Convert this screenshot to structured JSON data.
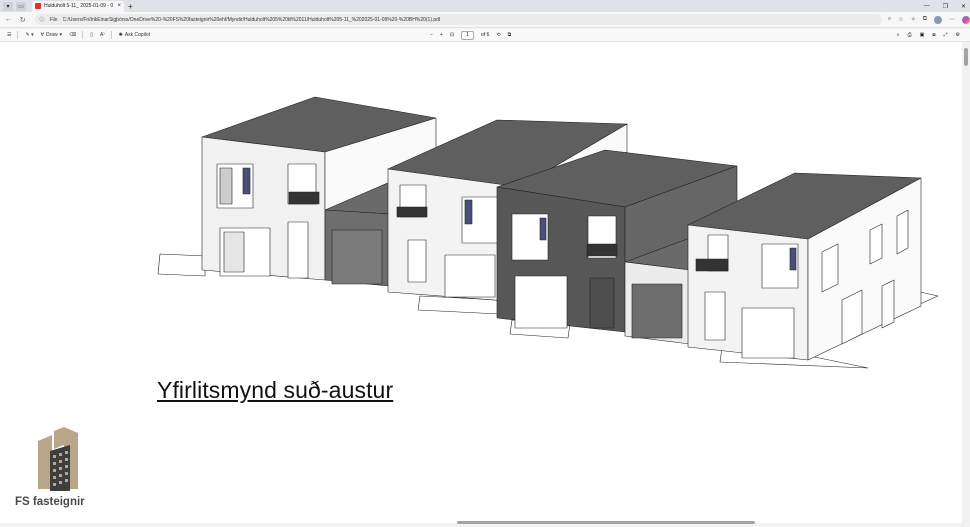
{
  "browser": {
    "tab_title": "Hulduholt 5-11_ 2025-01-09 - 0",
    "tab_close": "×",
    "new_tab": "+",
    "address_label": "File",
    "url": "C:/Users/FriðrikEinarSigþórss/OneDrive%20-%20FS%20fasteignir%20ehf/Myndir/Hulduholt%205%20til%2011/Hulduholt%205-11_%202025-01-09%20-%20BH%20(1).pdf"
  },
  "pdf_toolbar": {
    "draw_label": "Draw",
    "ask_copilot_label": "Ask Copilot",
    "zoom_out": "−",
    "zoom_in": "+",
    "current_page": "1",
    "page_total": "of 6"
  },
  "document": {
    "title": "Yfirlitsmynd suð-austur",
    "brand": "FS fasteignir"
  },
  "colors": {
    "logo_gold": "#b8a58a",
    "logo_dark": "#3e3e3e",
    "roof": "#5f5f5f",
    "dark_facade": "#575757",
    "garage": "#6e6e6e"
  }
}
